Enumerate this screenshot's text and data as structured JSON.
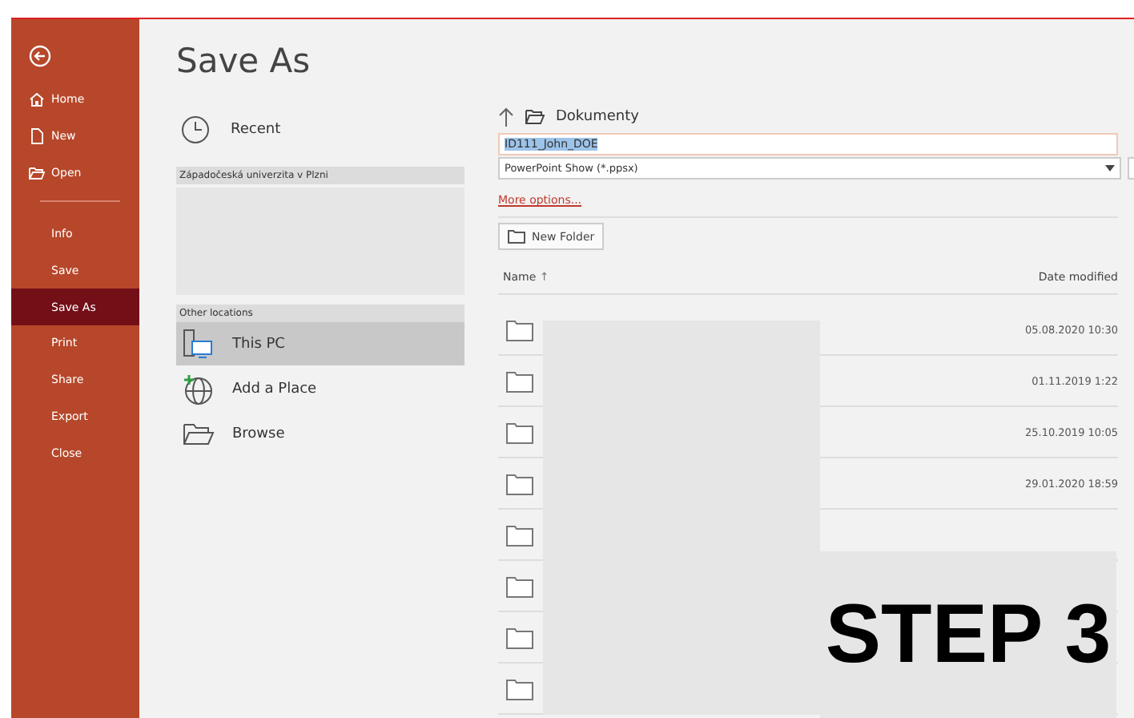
{
  "sidebar": {
    "items": [
      {
        "label": "Home",
        "selected": false
      },
      {
        "label": "New",
        "selected": false
      },
      {
        "label": "Open",
        "selected": false
      },
      {
        "label": "Info",
        "selected": false
      },
      {
        "label": "Save",
        "selected": false
      },
      {
        "label": "Save As",
        "selected": true
      },
      {
        "label": "Print",
        "selected": false
      },
      {
        "label": "Share",
        "selected": false
      },
      {
        "label": "Export",
        "selected": false
      },
      {
        "label": "Close",
        "selected": false
      }
    ]
  },
  "title": "Save As",
  "locations": {
    "recent": "Recent",
    "group_header": "Západočeská univerzita v Plzni",
    "other_header": "Other locations",
    "items": [
      {
        "label": "This PC",
        "selected": true
      },
      {
        "label": "Add a Place",
        "selected": false
      },
      {
        "label": "Browse",
        "selected": false
      }
    ]
  },
  "path": "Dokumenty",
  "file_name": "ID111_John_DOE",
  "file_type": "PowerPoint Show (*.ppsx)",
  "more_options": "More options...",
  "new_folder": "New Folder",
  "columns": {
    "name": "Name",
    "sort": "↑",
    "date": "Date modified"
  },
  "rows": [
    {
      "date": "05.08.2020 10:30"
    },
    {
      "date": "01.11.2019 1:22"
    },
    {
      "date": "25.10.2019 10:05"
    },
    {
      "date": "29.01.2020 18:59"
    },
    {},
    {},
    {},
    {}
  ],
  "banner": "STEP 3"
}
